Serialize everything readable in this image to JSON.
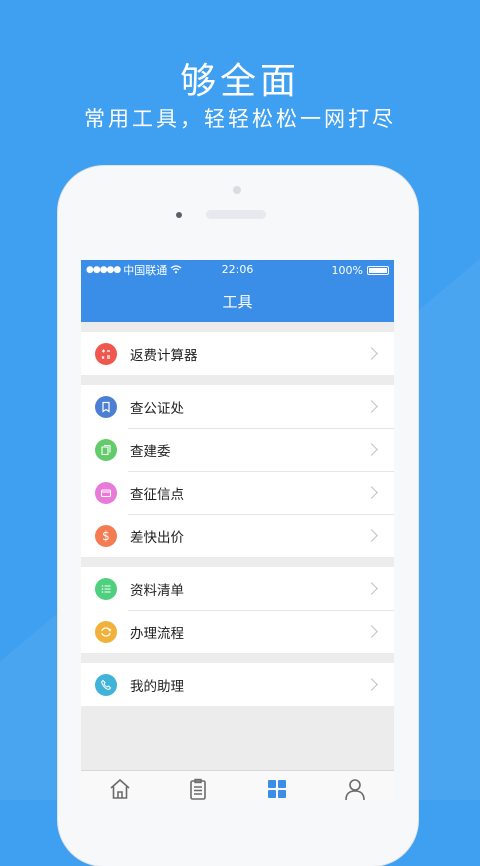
{
  "promo": {
    "headline": "够全面",
    "subline": "常用工具，轻轻松松一网打尽"
  },
  "status_bar": {
    "carrier": "中国联通",
    "time": "22:06",
    "battery": "100%"
  },
  "nav": {
    "title": "工具"
  },
  "groups": [
    [
      {
        "label": "返费计算器",
        "icon": "calculator-icon",
        "color": "#f0584f"
      }
    ],
    [
      {
        "label": "查公证处",
        "icon": "bookmark-icon",
        "color": "#4a7fd4"
      },
      {
        "label": "查建委",
        "icon": "documents-icon",
        "color": "#62cc6a"
      },
      {
        "label": "查征信点",
        "icon": "card-icon",
        "color": "#e87ad8"
      },
      {
        "label": "差快出价",
        "icon": "dollar-icon",
        "color": "#f37c52"
      }
    ],
    [
      {
        "label": "资料清单",
        "icon": "list-icon",
        "color": "#4ed07e"
      },
      {
        "label": "办理流程",
        "icon": "cycle-icon",
        "color": "#f1b23c"
      }
    ],
    [
      {
        "label": "我的助理",
        "icon": "phone-icon",
        "color": "#41b3d9"
      }
    ]
  ],
  "tabbar": [
    {
      "icon": "home-icon",
      "active": false
    },
    {
      "icon": "clipboard-icon",
      "active": false
    },
    {
      "icon": "grid-icon",
      "active": true
    },
    {
      "icon": "user-icon",
      "active": false
    }
  ],
  "colors": {
    "background": "#3f9ff0",
    "nav_blue": "#3a8ee8",
    "active_tab": "#3a8ee8",
    "inactive_tab": "#6b6b6b"
  }
}
